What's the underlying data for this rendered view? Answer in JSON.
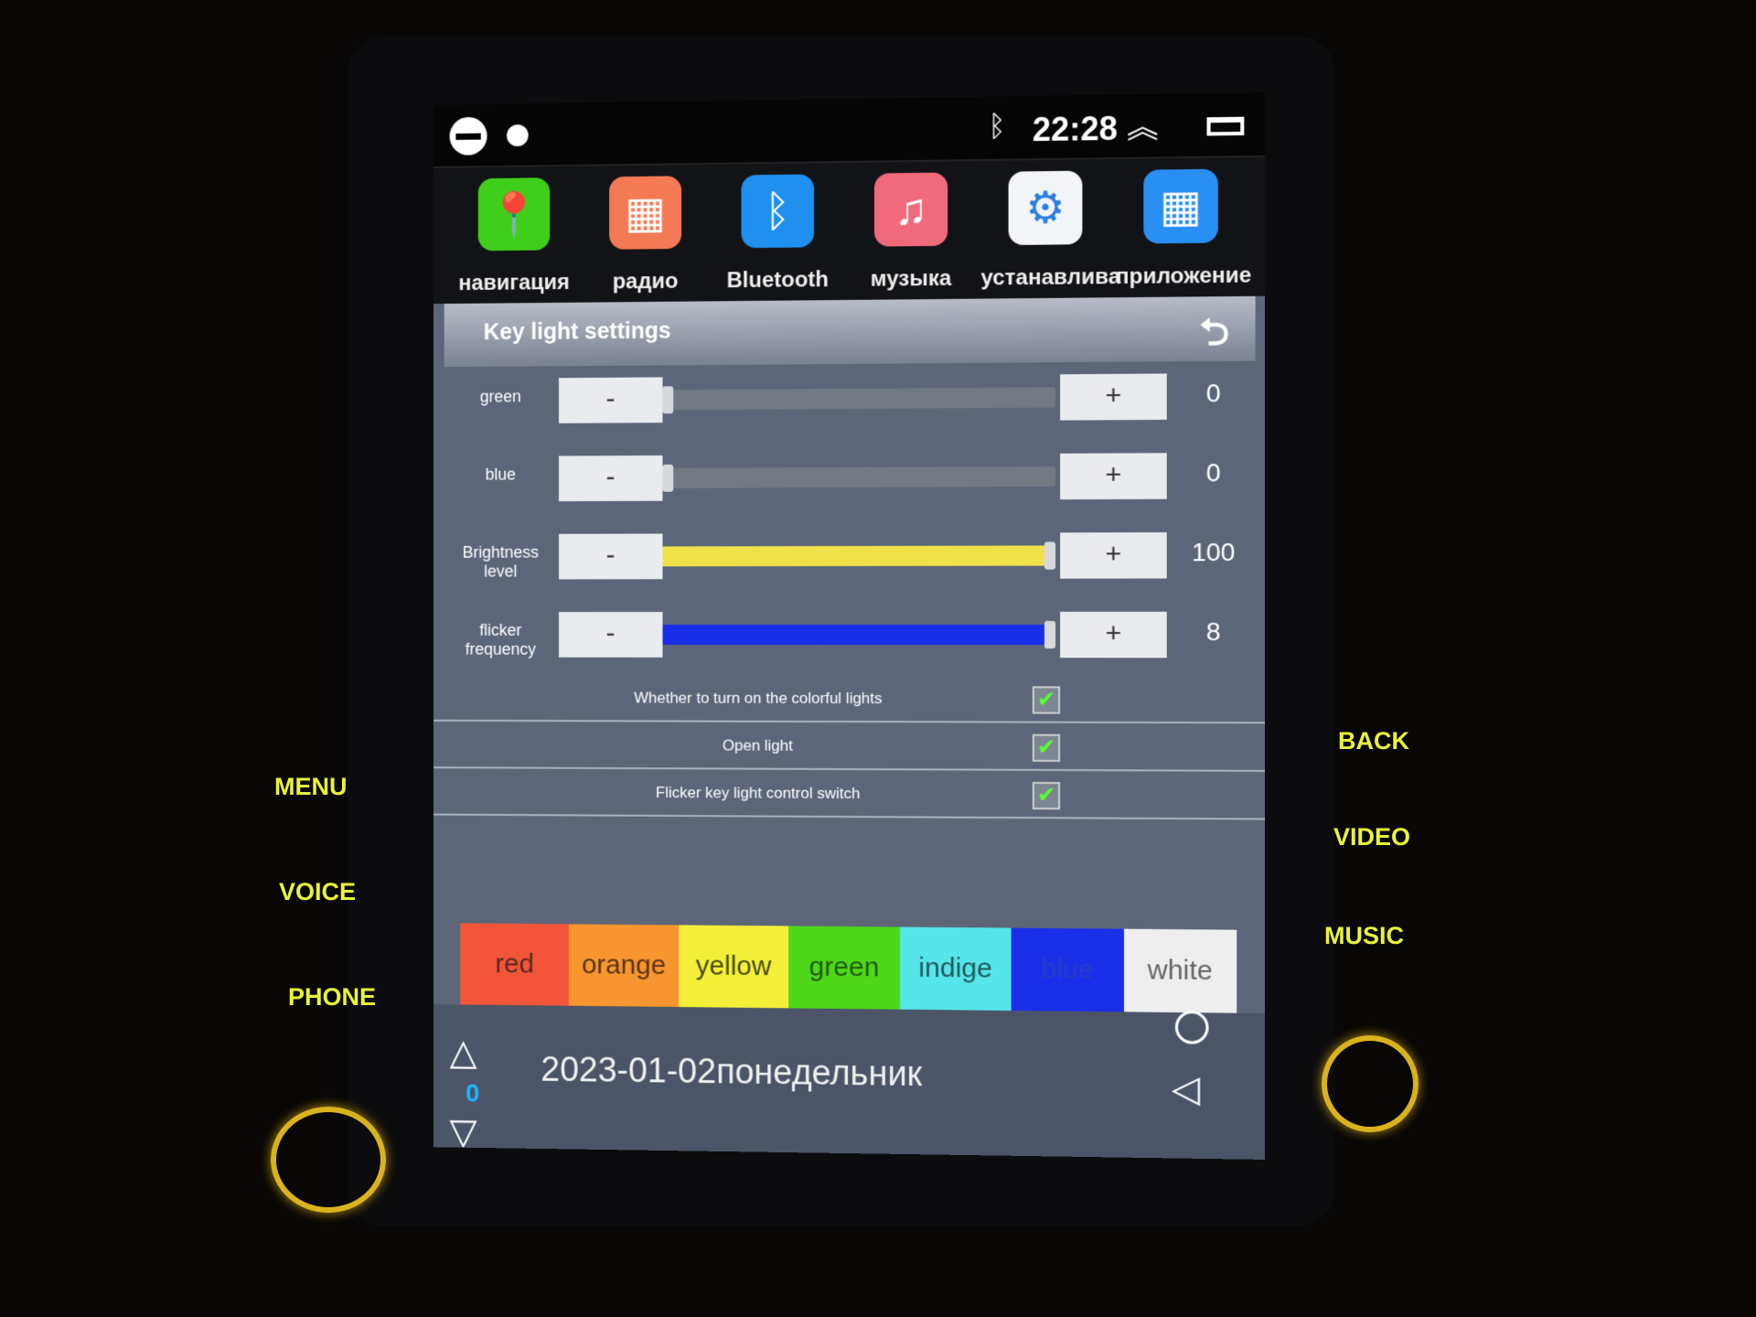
{
  "status_bar": {
    "time": "22:28",
    "icons": [
      "minus-circle-icon",
      "dot-icon",
      "bluetooth-icon",
      "chevron-up-double-icon",
      "recents-icon"
    ]
  },
  "apps": [
    {
      "label": "навигация",
      "icon": "map-pin-icon",
      "color": "#3fcf1a"
    },
    {
      "label": "радио",
      "icon": "radio-icon",
      "color": "#f47a55"
    },
    {
      "label": "Bluetooth",
      "icon": "bluetooth-icon",
      "color": "#1f8ff0"
    },
    {
      "label": "музыка",
      "icon": "music-note-icon",
      "color": "#f06a7c"
    },
    {
      "label": "устанавлива",
      "icon": "gear-icon",
      "color": "#f2f4f8"
    },
    {
      "label": "приложение",
      "icon": "apps-grid-icon",
      "color": "#2a8ff5"
    }
  ],
  "header": {
    "title": "Key light settings",
    "back_icon": "undo-icon"
  },
  "sliders": [
    {
      "label": "green",
      "minus": "-",
      "plus": "+",
      "value": "0",
      "percent": 0,
      "fill": "#737982"
    },
    {
      "label": "blue",
      "minus": "-",
      "plus": "+",
      "value": "0",
      "percent": 0,
      "fill": "#737982"
    },
    {
      "label": "Brightness level",
      "minus": "-",
      "plus": "+",
      "value": "100",
      "percent": 100,
      "fill": "#f0e04a"
    },
    {
      "label": "flicker frequency",
      "minus": "-",
      "plus": "+",
      "value": "8",
      "percent": 100,
      "fill": "#1a2ee8"
    }
  ],
  "checks": [
    {
      "label": "Whether to turn on the colorful lights",
      "checked": true
    },
    {
      "label": "Open light",
      "checked": true
    },
    {
      "label": "Flicker key light control switch",
      "checked": true
    }
  ],
  "colors": [
    {
      "label": "red",
      "bg": "#f2553a",
      "fg": "#5a2a20"
    },
    {
      "label": "orange",
      "bg": "#f7952f",
      "fg": "#5a3410"
    },
    {
      "label": "yellow",
      "bg": "#f4f03a",
      "fg": "#4a4a10"
    },
    {
      "label": "green",
      "bg": "#4fd81a",
      "fg": "#1f5a08"
    },
    {
      "label": "indige",
      "bg": "#56e6ea",
      "fg": "#1f5a5e"
    },
    {
      "label": "blue",
      "bg": "#1b2fe8",
      "fg": "#2a3ac8"
    },
    {
      "label": "white",
      "bg": "#eeeeee",
      "fg": "#666666"
    }
  ],
  "bottom": {
    "date": "2023-01-02",
    "weekday": "понедельник",
    "counter": "0"
  },
  "hardware": {
    "left": [
      "MENU",
      "VOICE",
      "PHONE"
    ],
    "right": [
      "BACK",
      "VIDEO",
      "MUSIC"
    ]
  }
}
